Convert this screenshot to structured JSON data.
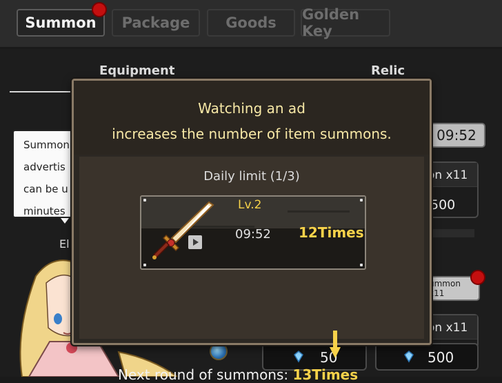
{
  "tabs": [
    {
      "label": "Summon",
      "active": true,
      "badge": true
    },
    {
      "label": "Package",
      "active": false
    },
    {
      "label": "Goods",
      "active": false
    },
    {
      "label": "Golden Key",
      "active": false
    }
  ],
  "subtabs": {
    "equipment": "Equipment",
    "relic": "Relic"
  },
  "bubble": {
    "lines": [
      "Summon",
      "advertis",
      "can be u",
      "minutes"
    ]
  },
  "character_name_fragment": "El",
  "right_panel": {
    "timer": "09:52",
    "summon_label_1": "on x11",
    "summon_value_1": "500",
    "summon_button": "ummon x11",
    "summon_label_2": "on x11"
  },
  "bottom": {
    "cost_left": "50",
    "cost_right": "500"
  },
  "modal": {
    "title_line1": "Watching an ad",
    "title_line2": "increases the number of item summons.",
    "daily_limit": "Daily limit (1/3)",
    "item": {
      "level": "Lv.2",
      "countdown": "09:52",
      "times": "12Times",
      "icon": "sword-icon"
    },
    "next_label": "Next round of summons: ",
    "next_value": "13Times"
  },
  "colors": {
    "accent_yellow": "#f7d24a",
    "title_yellow": "#f7e8a6",
    "badge_red": "#c40f0f"
  }
}
